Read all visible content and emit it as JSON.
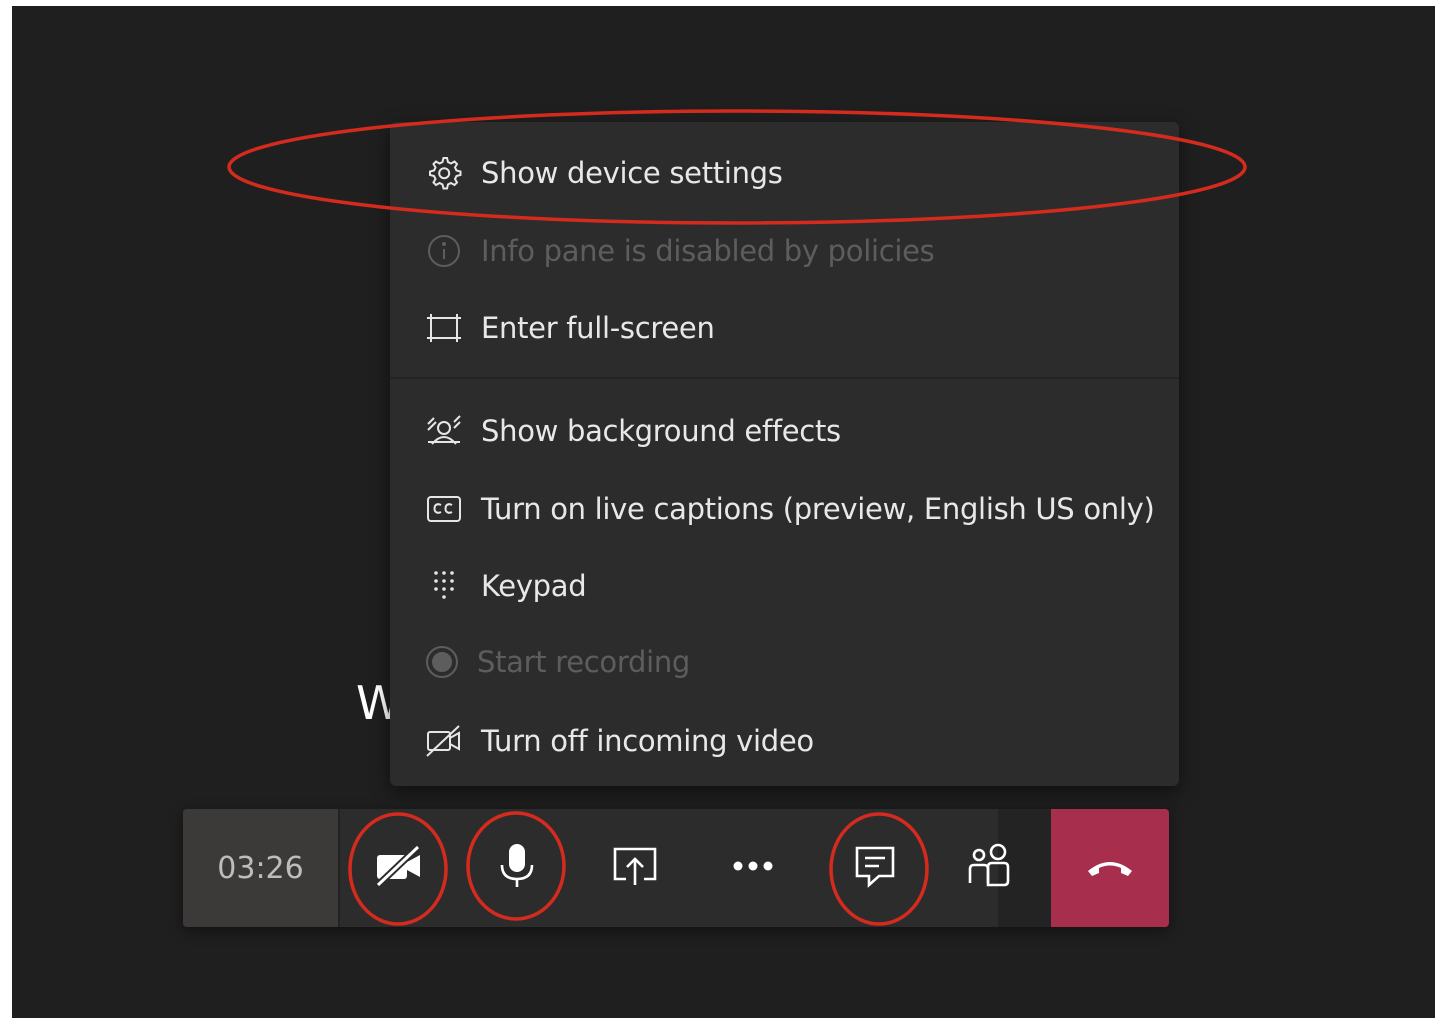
{
  "meeting": {
    "caller_name_fragment": "W"
  },
  "menu": {
    "items": [
      {
        "label": "Show device settings",
        "icon": "gear-icon",
        "enabled": true
      },
      {
        "label": "Info pane is disabled by policies",
        "icon": "info-icon",
        "enabled": false
      },
      {
        "label": "Enter full-screen",
        "icon": "fullscreen-icon",
        "enabled": true
      },
      {
        "label": "Show background effects",
        "icon": "background-effects-icon",
        "enabled": true
      },
      {
        "label": "Turn on live captions (preview, English US only)",
        "icon": "closed-captions-icon",
        "enabled": true
      },
      {
        "label": "Keypad",
        "icon": "keypad-icon",
        "enabled": true
      },
      {
        "label": "Start recording",
        "icon": "record-icon",
        "enabled": false
      },
      {
        "label": "Turn off incoming video",
        "icon": "video-off-icon",
        "enabled": true
      }
    ]
  },
  "callbar": {
    "timer": "03:26",
    "buttons": [
      {
        "name": "camera-toggle",
        "icon": "camera-off-icon"
      },
      {
        "name": "mic-toggle",
        "icon": "microphone-icon"
      },
      {
        "name": "share-screen",
        "icon": "share-screen-icon"
      },
      {
        "name": "more-actions",
        "icon": "more-icon"
      },
      {
        "name": "show-conversation",
        "icon": "chat-icon"
      },
      {
        "name": "show-participants",
        "icon": "participants-icon"
      },
      {
        "name": "hang-up",
        "icon": "hang-up-icon"
      }
    ],
    "hangup_color": "#a72f4d"
  },
  "annotations": {
    "color": "#d42b1e"
  }
}
